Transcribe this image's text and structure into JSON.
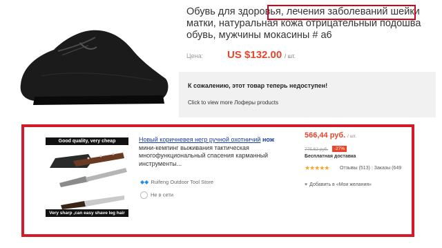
{
  "product": {
    "title": "Обувь для здоровья, лечения заболеваний шейки матки, натуральная кожа отрицательный подошва обувь, мужчины мокасины # а6",
    "price_label": "Цена:",
    "price": "US $132.00",
    "price_unit": "/ шт.",
    "unavailable_text": "К сожалению, этот товар теперь недоступен!",
    "more_link": "Click to view more Лоферы products"
  },
  "listing": {
    "image_caption_top": "Good quality, very cheap",
    "image_caption_bottom": "Very sharp ,can easy shave leg hair",
    "title_line1": "Новый коричневея негр ручной охотничий",
    "title_keyword": "нож",
    "title_rest": "мини-кемпинг выживания тактическая многофункциональный спасения карманный инструменты...",
    "store_name": "Ruifeng Outdoor Tool Store",
    "online_status": "Не в сети",
    "price": "566,44 руб.",
    "price_unit": "/ шт.",
    "old_price": "775,62 руб.",
    "discount": "-27%",
    "shipping": "Бесплатная доставка",
    "stars_glyph": "★★★★★",
    "reviews": "Отзывы (513)",
    "orders": "Заказы (649",
    "wishlist": "Добавить в «Мои желания»"
  },
  "colors": {
    "highlight_red": "#d11a2a",
    "price_orange": "#e8452a",
    "link_blue": "#1a3ea8",
    "star_gold": "#f5a623"
  }
}
